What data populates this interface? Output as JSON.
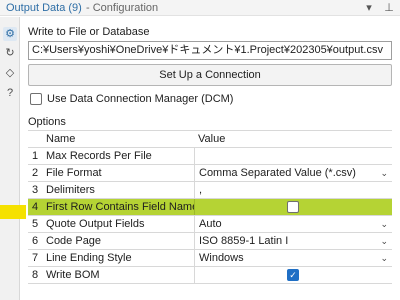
{
  "window": {
    "title": "Output Data (9)",
    "subtitle": "- Configuration",
    "dropdown_glyph": "▾",
    "pin_glyph": "⊥"
  },
  "rail": {
    "items": [
      {
        "icon": "gear-icon",
        "glyph": "⚙"
      },
      {
        "icon": "refresh-icon",
        "glyph": "↻"
      },
      {
        "icon": "tag-icon",
        "glyph": "◇"
      },
      {
        "icon": "help-icon",
        "glyph": "?"
      }
    ]
  },
  "write": {
    "label": "Write to File or Database",
    "path": "C:¥Users¥yoshi¥OneDrive¥ドキュメント¥1.Project¥202305¥output.csv",
    "setup_label": "Set Up a Connection",
    "dcm_label": "Use Data Connection Manager (DCM)",
    "dcm_checked": false
  },
  "options": {
    "label": "Options",
    "columns": [
      "Name",
      "Value"
    ],
    "rows": [
      {
        "num": "1",
        "name": "Max Records Per File",
        "value": "",
        "control": "text"
      },
      {
        "num": "2",
        "name": "File Format",
        "value": "Comma Separated Value (*.csv)",
        "control": "dropdown"
      },
      {
        "num": "3",
        "name": "Delimiters",
        "value": ",",
        "control": "text"
      },
      {
        "num": "4",
        "name": "First Row Contains Field Names",
        "value": "",
        "control": "checkbox",
        "checked": false,
        "highlight": true
      },
      {
        "num": "5",
        "name": "Quote Output Fields",
        "value": "Auto",
        "control": "dropdown"
      },
      {
        "num": "6",
        "name": "Code Page",
        "value": "ISO 8859-1 Latin I",
        "control": "dropdown"
      },
      {
        "num": "7",
        "name": "Line Ending Style",
        "value": "Windows",
        "control": "dropdown"
      },
      {
        "num": "8",
        "name": "Write BOM",
        "value": "",
        "control": "checkbox",
        "checked": true
      }
    ],
    "dropdown_glyph": "⌄",
    "check_glyph": "✓"
  },
  "colors": {
    "highlight_row": "#b5d334",
    "marker": "#f5e100",
    "title": "#2e6ea6",
    "checkbox_checked": "#1f6fc5"
  }
}
